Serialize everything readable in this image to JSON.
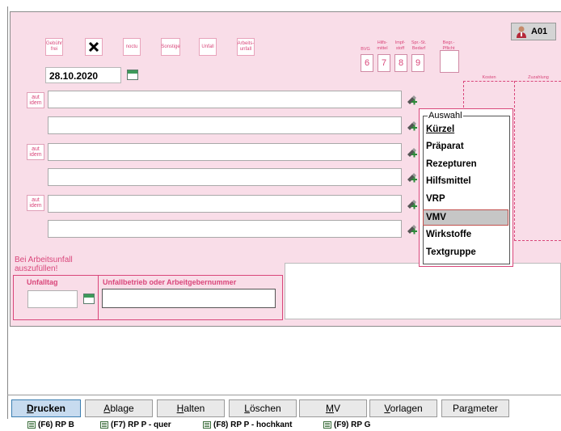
{
  "badge": {
    "label": "A01"
  },
  "checkboxes": [
    {
      "label": "Gebühr frei"
    },
    {
      "label": "noctu"
    },
    {
      "label": "Sonstige"
    },
    {
      "label": "Unfall"
    },
    {
      "label": "Arbeits-unfall"
    }
  ],
  "header_cols": {
    "bvg": "BVG",
    "hilfsmittel": "Hilfs-mittel",
    "impfstoff": "Impf-stoff",
    "spr_st_bedarf": "Spr.-St. Bedarf",
    "begr_pflicht": "Begr.-Pflicht"
  },
  "codes": [
    "6",
    "7",
    "8",
    "9"
  ],
  "date": {
    "value": "28.10.2020"
  },
  "aut_idem": "aut idem",
  "cost_cols": {
    "kosten": "Kosten",
    "zuzahlung": "Zuzahlung"
  },
  "popup": {
    "title": "Auswahl",
    "items": [
      "Kürzel",
      "Präparat",
      "Rezepturen",
      "Hilfsmittel",
      "VRP",
      "VMV",
      "Wirkstoffe",
      "Textgruppe"
    ],
    "selected": "VMV"
  },
  "accident": {
    "note": "Bei Arbeitsunfall auszufüllen!",
    "unfalltag_label": "Unfalltag",
    "unfallbetrieb_label": "Unfallbetrieb oder Arbeitgebernummer",
    "unfalltag_value": "",
    "unfallbetrieb_value": ""
  },
  "buttons": [
    "Drucken",
    "Ablage",
    "Halten",
    "Löschen",
    "MV",
    "Vorlagen",
    "Parameter"
  ],
  "fkeys": [
    "(F6) RP B",
    "(F7) RP P - quer",
    "(F8) RP P - hochkant",
    "(F9) RP G"
  ],
  "colors": {
    "accent": "#d9467a",
    "form_bg": "#f9dde8",
    "primary_button": "#c7dbef"
  }
}
